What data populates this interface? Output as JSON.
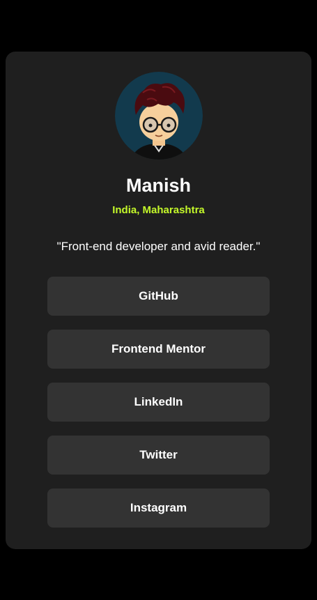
{
  "profile": {
    "avatar_icon": "avatar-illustration",
    "name": "Manish",
    "location": "India, Maharashtra",
    "bio": "\"Front-end developer and avid reader.\""
  },
  "links": [
    {
      "label": "GitHub"
    },
    {
      "label": "Frontend Mentor"
    },
    {
      "label": "LinkedIn"
    },
    {
      "label": "Twitter"
    },
    {
      "label": "Instagram"
    }
  ],
  "colors": {
    "page_background": "#000000",
    "card_background": "#1f1f1f",
    "button_background": "#333333",
    "accent": "#c4f82a",
    "text": "#ffffff"
  }
}
